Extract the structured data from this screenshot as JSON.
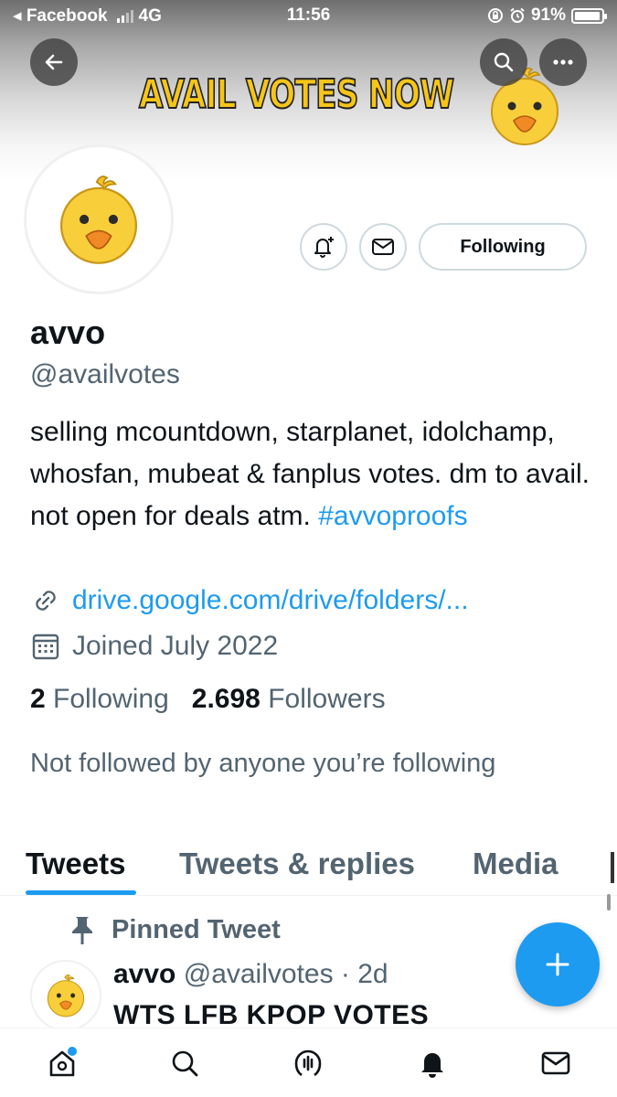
{
  "status_bar": {
    "back_app": "◂ Facebook",
    "network": "4G",
    "time": "11:56",
    "battery": "91%"
  },
  "banner": {
    "text": "AVAIL VOTES NOW"
  },
  "profile": {
    "follow_button": "Following",
    "name": "avvo",
    "handle": "@availvotes",
    "bio_text": "selling mcountdown, starplanet, idolchamp, whosfan, mubeat & fanplus votes. dm to avail. not open for deals atm. ",
    "bio_hashtag": "#avvoproofs",
    "link": "drive.google.com/drive/folders/...",
    "joined": "Joined July 2022",
    "following_count": "2",
    "following_label": "Following",
    "followers_count": "2.698",
    "followers_label": "Followers",
    "not_followed": "Not followed by anyone you’re following"
  },
  "tabs": [
    {
      "label": "Tweets",
      "active": true
    },
    {
      "label": "Tweets & replies",
      "active": false
    },
    {
      "label": "Media",
      "active": false
    }
  ],
  "pinned": {
    "label": "Pinned Tweet",
    "author": "avvo",
    "handle_time": "@availvotes · 2d",
    "text": "WTS LFB KPOP VOTES"
  },
  "colors": {
    "accent": "#1d9bf0",
    "text_primary": "#0f1419",
    "text_secondary": "#536471",
    "banner_text": "#f5c518"
  },
  "icons": {
    "avatar": "duck-icon",
    "nav": [
      "home-icon",
      "search-icon",
      "spaces-icon",
      "notifications-icon",
      "messages-icon"
    ]
  }
}
